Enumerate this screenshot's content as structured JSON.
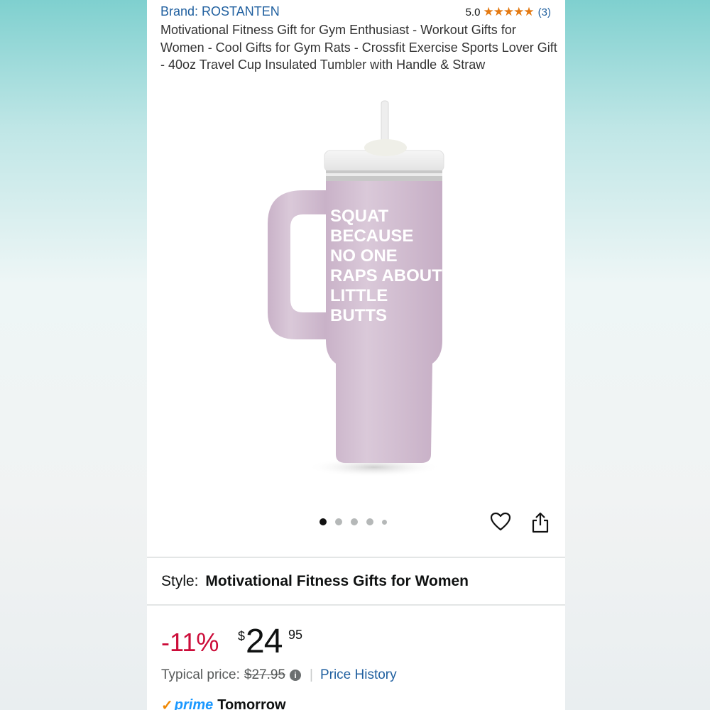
{
  "header": {
    "brand": "Brand: ROSTANTEN",
    "rating_value": "5.0",
    "stars": "★★★★★",
    "rating_count": "(3)"
  },
  "product": {
    "title": "Motivational Fitness Gift for Gym Enthusiast - Workout Gifts for Women - Cool Gifts for Gym Rats - Crossfit Exercise Sports Lover Gift - 40oz Travel Cup Insulated Tumbler with Handle & Straw",
    "image_text": [
      "SQUAT",
      "BECAUSE",
      "NO ONE",
      "RAPS ABOUT",
      "LITTLE",
      "BUTTS"
    ],
    "carousel_count": 5,
    "carousel_active": 1
  },
  "style": {
    "label": "Style:",
    "value": "Motivational Fitness Gifts for Women"
  },
  "price": {
    "discount": "-11%",
    "currency": "$",
    "whole": "24",
    "fraction": "95",
    "typical_label": "Typical price:",
    "typical_value": "$27.95",
    "price_history": "Price History"
  },
  "delivery": {
    "prime_label": "prime",
    "day": "Tomorrow"
  },
  "colors": {
    "link": "#1f5f9f",
    "discount": "#cc0c39",
    "stars": "#e47911",
    "tumbler": "#d3bfd2",
    "prime": "#1a98ff"
  },
  "icons": [
    "heart-icon",
    "share-icon",
    "info-icon",
    "star-icon"
  ]
}
